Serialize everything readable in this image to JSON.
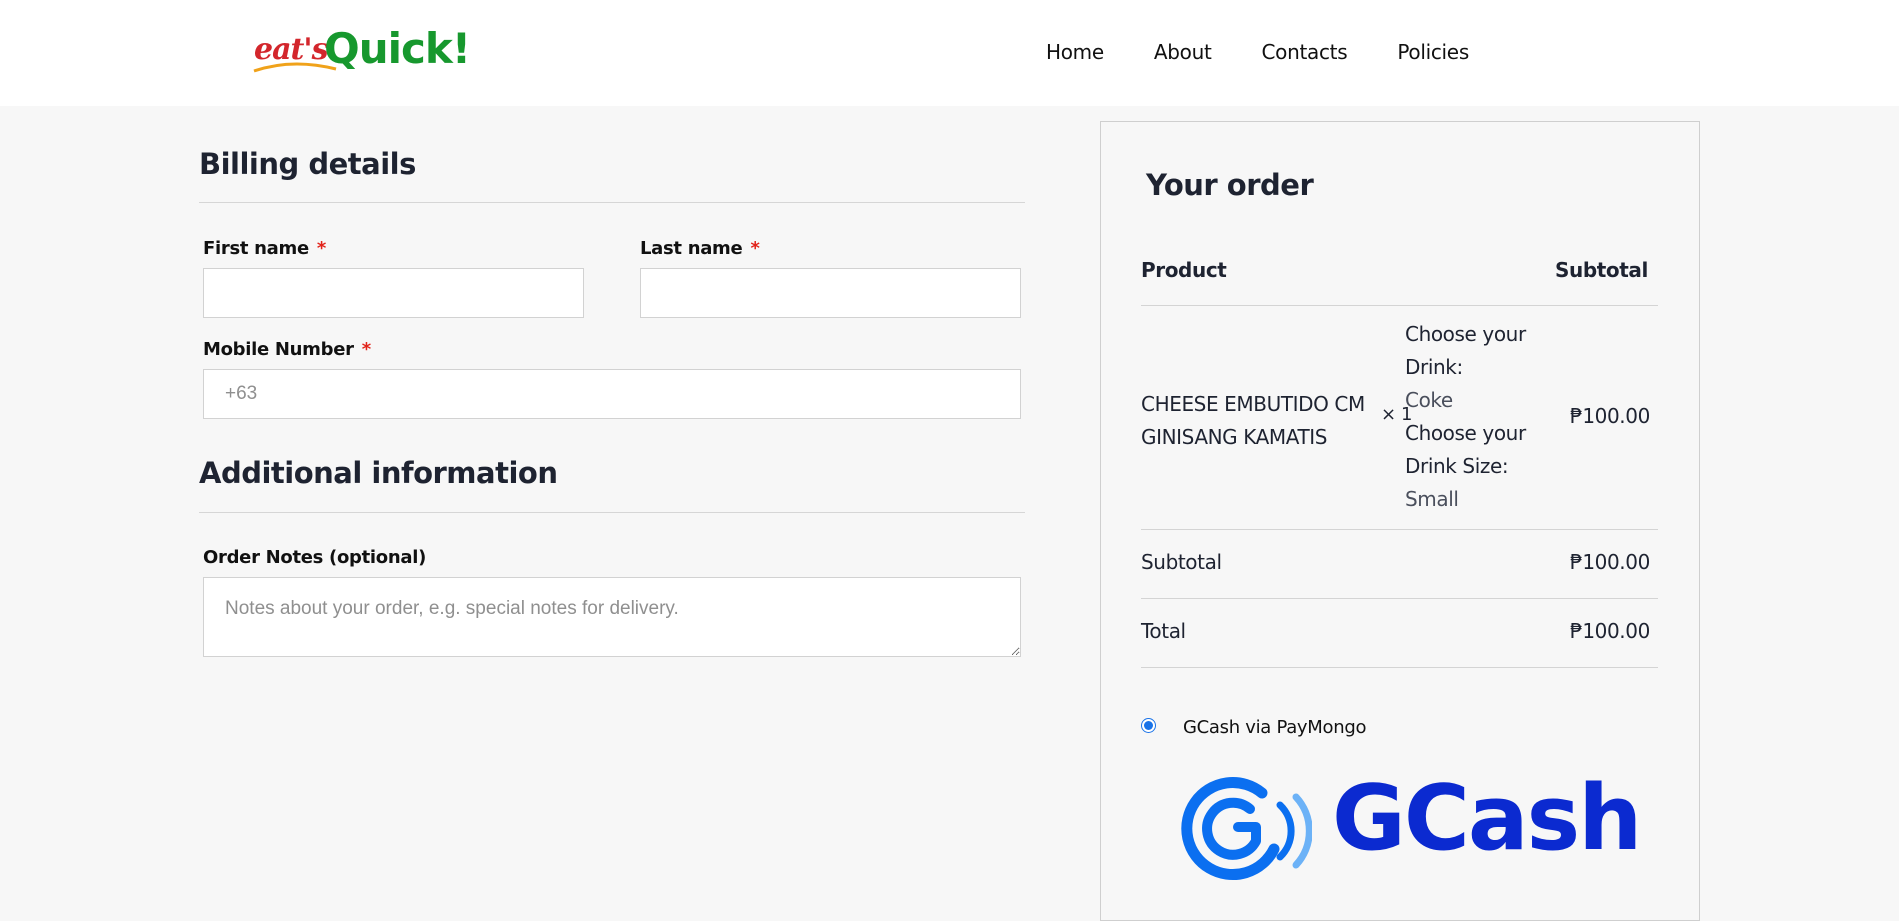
{
  "header": {
    "logo_small": "eat's",
    "logo_big": "Quick!",
    "nav": [
      "Home",
      "About",
      "Contacts",
      "Policies"
    ]
  },
  "billing": {
    "title": "Billing details",
    "first_name_label": "First name",
    "last_name_label": "Last name",
    "required_mark": "*",
    "mobile_label": "Mobile Number",
    "mobile_placeholder": "+63"
  },
  "additional": {
    "title": "Additional information",
    "notes_label": "Order Notes (optional)",
    "notes_placeholder": "Notes about your order, e.g. special notes for delivery."
  },
  "order": {
    "title": "Your order",
    "col_product": "Product",
    "col_subtotal": "Subtotal",
    "item": {
      "name_line1": "CHEESE EMBUTIDO CM",
      "name_line2": "GINISANG KAMATIS",
      "qty": "× 1",
      "meta1_key_line1": "Choose your",
      "meta1_key_line2": "Drink:",
      "meta1_val": "Coke",
      "meta2_key_line1": "Choose your",
      "meta2_key_line2": "Drink Size:",
      "meta2_val": "Small",
      "price": "₱100.00"
    },
    "subtotal_label": "Subtotal",
    "subtotal_value": "₱100.00",
    "total_label": "Total",
    "total_value": "₱100.00",
    "payment_method": "GCash via PayMongo",
    "payment_selected": true,
    "payment_logo_text": "GCash"
  },
  "colors": {
    "accent_blue": "#1a73e8",
    "gcash_blue": "#0b2ad0",
    "required_red": "#e2231a",
    "logo_green": "#17982e",
    "logo_red": "#d3262c"
  }
}
